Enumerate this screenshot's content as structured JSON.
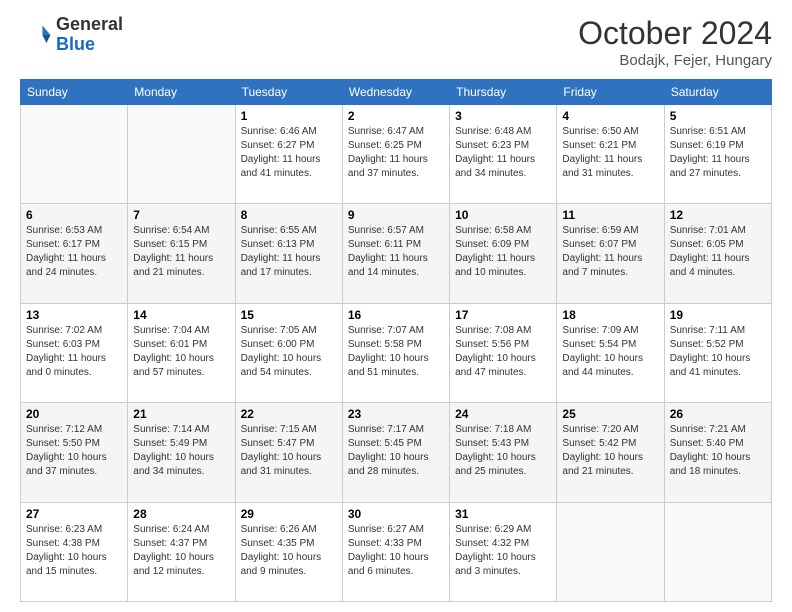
{
  "header": {
    "logo_general": "General",
    "logo_blue": "Blue",
    "month_title": "October 2024",
    "subtitle": "Bodajk, Fejer, Hungary"
  },
  "days_of_week": [
    "Sunday",
    "Monday",
    "Tuesday",
    "Wednesday",
    "Thursday",
    "Friday",
    "Saturday"
  ],
  "weeks": [
    [
      {
        "day": "",
        "info": ""
      },
      {
        "day": "",
        "info": ""
      },
      {
        "day": "1",
        "info": "Sunrise: 6:46 AM\nSunset: 6:27 PM\nDaylight: 11 hours and 41 minutes."
      },
      {
        "day": "2",
        "info": "Sunrise: 6:47 AM\nSunset: 6:25 PM\nDaylight: 11 hours and 37 minutes."
      },
      {
        "day": "3",
        "info": "Sunrise: 6:48 AM\nSunset: 6:23 PM\nDaylight: 11 hours and 34 minutes."
      },
      {
        "day": "4",
        "info": "Sunrise: 6:50 AM\nSunset: 6:21 PM\nDaylight: 11 hours and 31 minutes."
      },
      {
        "day": "5",
        "info": "Sunrise: 6:51 AM\nSunset: 6:19 PM\nDaylight: 11 hours and 27 minutes."
      }
    ],
    [
      {
        "day": "6",
        "info": "Sunrise: 6:53 AM\nSunset: 6:17 PM\nDaylight: 11 hours and 24 minutes."
      },
      {
        "day": "7",
        "info": "Sunrise: 6:54 AM\nSunset: 6:15 PM\nDaylight: 11 hours and 21 minutes."
      },
      {
        "day": "8",
        "info": "Sunrise: 6:55 AM\nSunset: 6:13 PM\nDaylight: 11 hours and 17 minutes."
      },
      {
        "day": "9",
        "info": "Sunrise: 6:57 AM\nSunset: 6:11 PM\nDaylight: 11 hours and 14 minutes."
      },
      {
        "day": "10",
        "info": "Sunrise: 6:58 AM\nSunset: 6:09 PM\nDaylight: 11 hours and 10 minutes."
      },
      {
        "day": "11",
        "info": "Sunrise: 6:59 AM\nSunset: 6:07 PM\nDaylight: 11 hours and 7 minutes."
      },
      {
        "day": "12",
        "info": "Sunrise: 7:01 AM\nSunset: 6:05 PM\nDaylight: 11 hours and 4 minutes."
      }
    ],
    [
      {
        "day": "13",
        "info": "Sunrise: 7:02 AM\nSunset: 6:03 PM\nDaylight: 11 hours and 0 minutes."
      },
      {
        "day": "14",
        "info": "Sunrise: 7:04 AM\nSunset: 6:01 PM\nDaylight: 10 hours and 57 minutes."
      },
      {
        "day": "15",
        "info": "Sunrise: 7:05 AM\nSunset: 6:00 PM\nDaylight: 10 hours and 54 minutes."
      },
      {
        "day": "16",
        "info": "Sunrise: 7:07 AM\nSunset: 5:58 PM\nDaylight: 10 hours and 51 minutes."
      },
      {
        "day": "17",
        "info": "Sunrise: 7:08 AM\nSunset: 5:56 PM\nDaylight: 10 hours and 47 minutes."
      },
      {
        "day": "18",
        "info": "Sunrise: 7:09 AM\nSunset: 5:54 PM\nDaylight: 10 hours and 44 minutes."
      },
      {
        "day": "19",
        "info": "Sunrise: 7:11 AM\nSunset: 5:52 PM\nDaylight: 10 hours and 41 minutes."
      }
    ],
    [
      {
        "day": "20",
        "info": "Sunrise: 7:12 AM\nSunset: 5:50 PM\nDaylight: 10 hours and 37 minutes."
      },
      {
        "day": "21",
        "info": "Sunrise: 7:14 AM\nSunset: 5:49 PM\nDaylight: 10 hours and 34 minutes."
      },
      {
        "day": "22",
        "info": "Sunrise: 7:15 AM\nSunset: 5:47 PM\nDaylight: 10 hours and 31 minutes."
      },
      {
        "day": "23",
        "info": "Sunrise: 7:17 AM\nSunset: 5:45 PM\nDaylight: 10 hours and 28 minutes."
      },
      {
        "day": "24",
        "info": "Sunrise: 7:18 AM\nSunset: 5:43 PM\nDaylight: 10 hours and 25 minutes."
      },
      {
        "day": "25",
        "info": "Sunrise: 7:20 AM\nSunset: 5:42 PM\nDaylight: 10 hours and 21 minutes."
      },
      {
        "day": "26",
        "info": "Sunrise: 7:21 AM\nSunset: 5:40 PM\nDaylight: 10 hours and 18 minutes."
      }
    ],
    [
      {
        "day": "27",
        "info": "Sunrise: 6:23 AM\nSunset: 4:38 PM\nDaylight: 10 hours and 15 minutes."
      },
      {
        "day": "28",
        "info": "Sunrise: 6:24 AM\nSunset: 4:37 PM\nDaylight: 10 hours and 12 minutes."
      },
      {
        "day": "29",
        "info": "Sunrise: 6:26 AM\nSunset: 4:35 PM\nDaylight: 10 hours and 9 minutes."
      },
      {
        "day": "30",
        "info": "Sunrise: 6:27 AM\nSunset: 4:33 PM\nDaylight: 10 hours and 6 minutes."
      },
      {
        "day": "31",
        "info": "Sunrise: 6:29 AM\nSunset: 4:32 PM\nDaylight: 10 hours and 3 minutes."
      },
      {
        "day": "",
        "info": ""
      },
      {
        "day": "",
        "info": ""
      }
    ]
  ]
}
